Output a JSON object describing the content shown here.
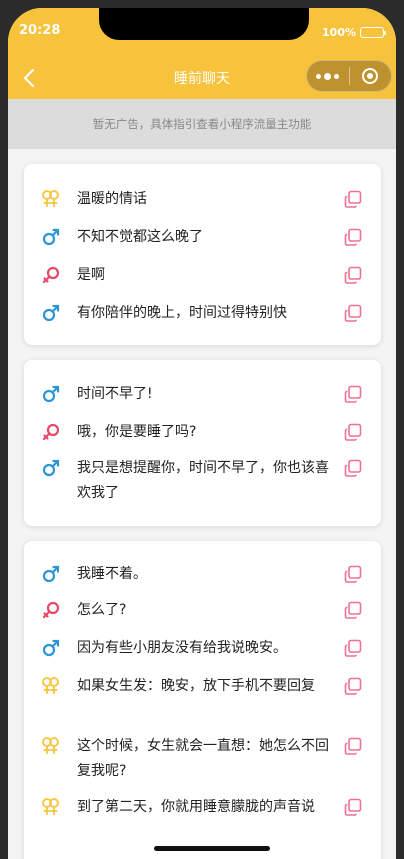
{
  "status": {
    "time": "20:28",
    "battery": "100%"
  },
  "nav": {
    "title": "睡前聊天",
    "back_icon": "back-arrow-icon"
  },
  "ad": {
    "text": "暂无广告，具体指引查看小程序流量主功能"
  },
  "colors": {
    "header": "#f7c23c",
    "male": "#2b95d6",
    "female": "#e8476a",
    "pair": "#f5c84a",
    "copy": "#f07090"
  },
  "cards": [
    {
      "lines": [
        {
          "gender": "pair",
          "text": "温暖的情话"
        },
        {
          "gender": "male",
          "text": "不知不觉都这么晚了"
        },
        {
          "gender": "female",
          "text": "是啊"
        },
        {
          "gender": "male",
          "text": "有你陪伴的晚上，时间过得特别快"
        }
      ]
    },
    {
      "lines": [
        {
          "gender": "male",
          "text": "时间不早了!"
        },
        {
          "gender": "female",
          "text": "哦，你是要睡了吗?"
        },
        {
          "gender": "male",
          "text": "我只是想提醒你，时间不早了，你也该喜欢我了"
        }
      ]
    },
    {
      "lines": [
        {
          "gender": "male",
          "text": "我睡不着。"
        },
        {
          "gender": "female",
          "text": "怎么了?"
        },
        {
          "gender": "male",
          "text": "因为有些小朋友没有给我说晚安。"
        },
        {
          "gender": "pair",
          "text": "如果女生发：晚安，放下手机不要回复"
        },
        {
          "gender": "pair",
          "text": "这个时候，女生就会一直想：她怎么不回复我呢?"
        },
        {
          "gender": "pair",
          "text": "到了第二天，你就用睡意朦胧的声音说"
        }
      ]
    }
  ]
}
